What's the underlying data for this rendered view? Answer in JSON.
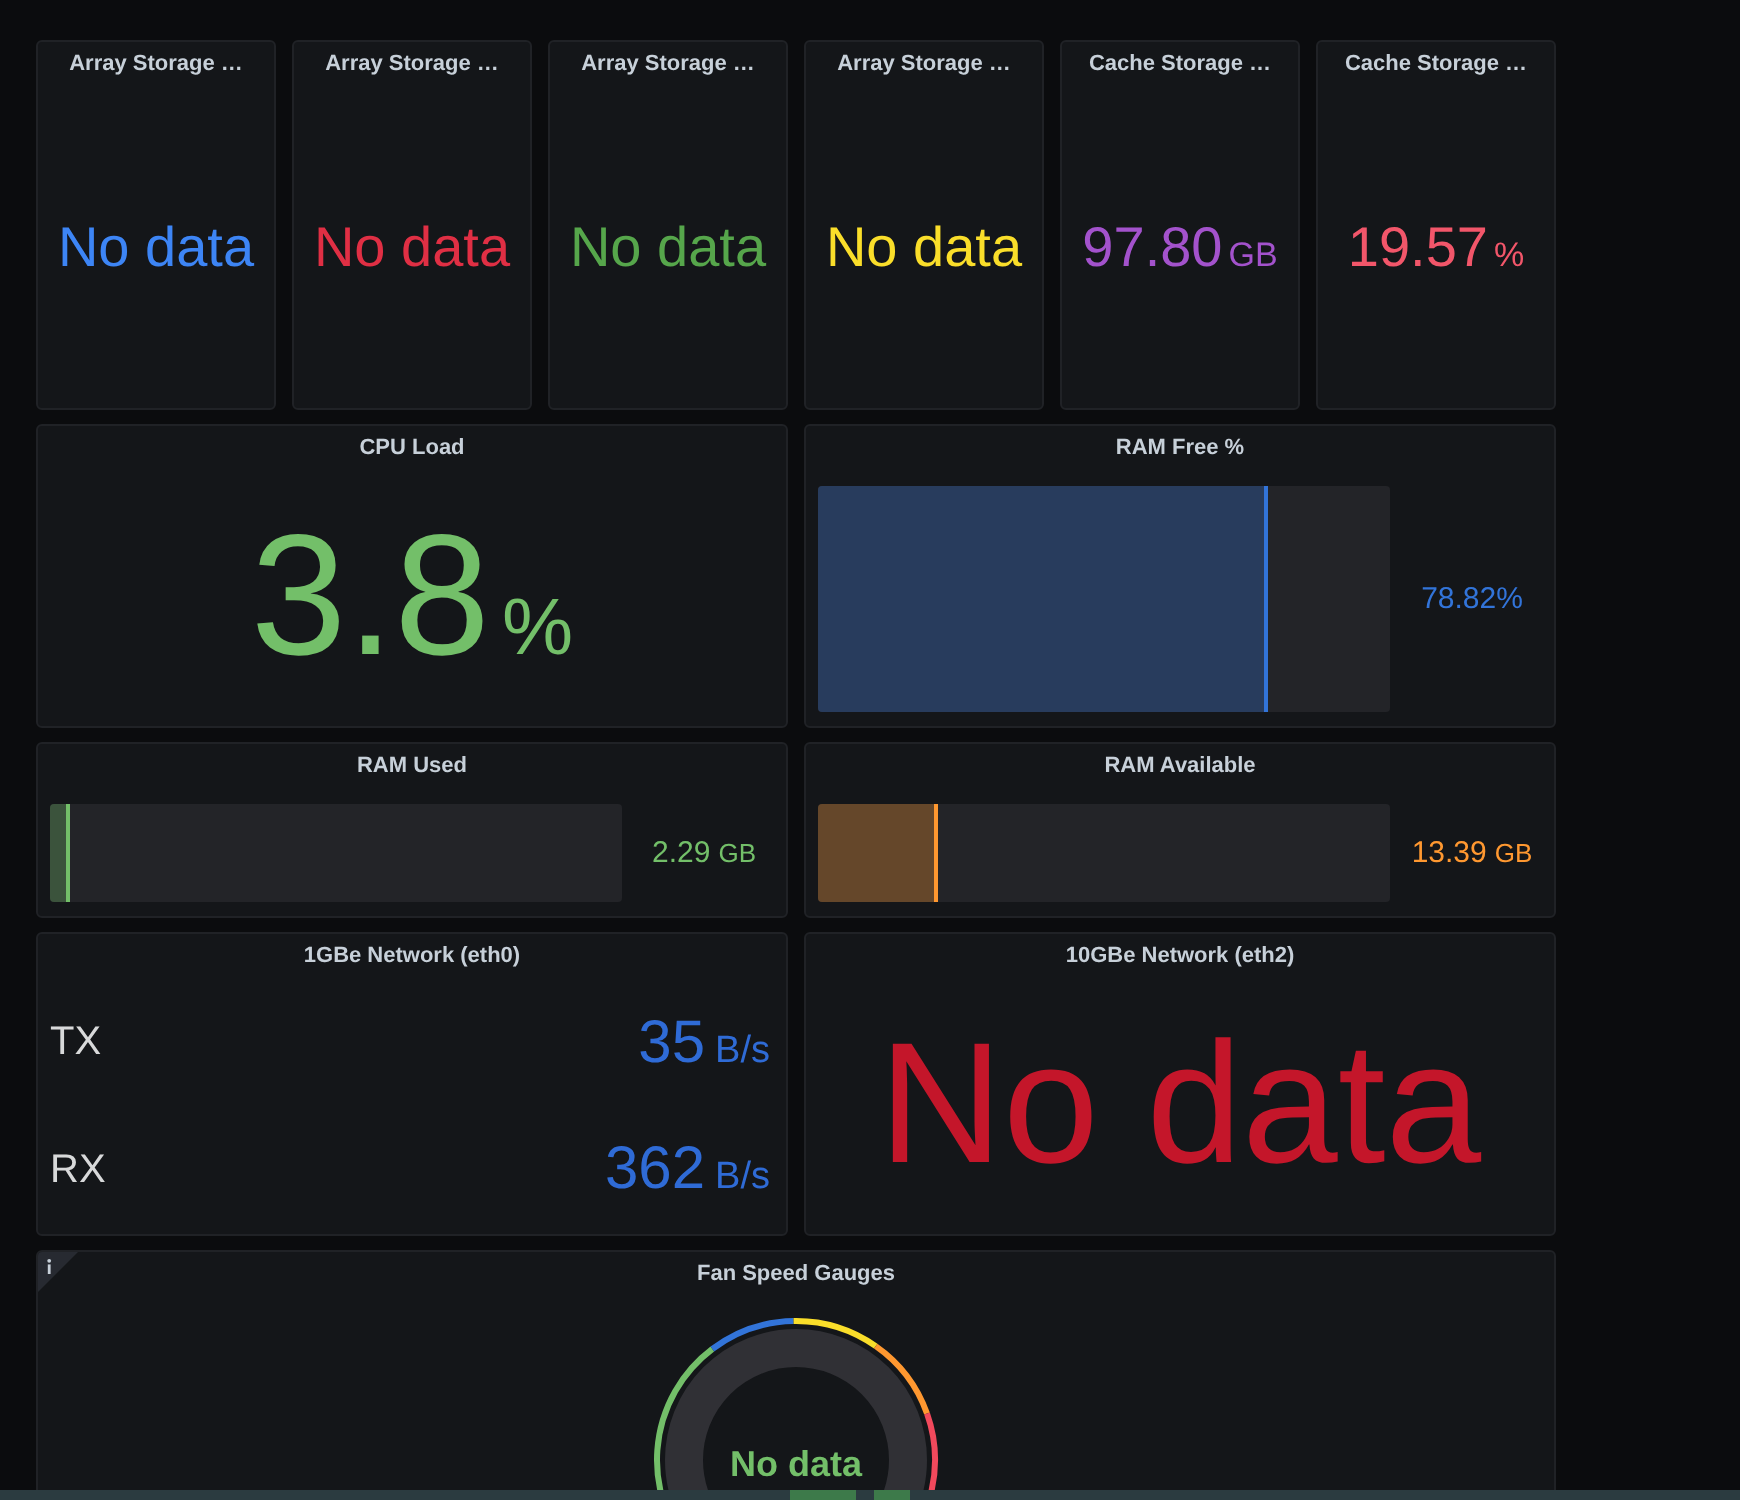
{
  "rows": [
    {
      "panels": [
        {
          "kind": "stat",
          "title": "Array Storage …",
          "value": "No data",
          "color": "#3d85f5"
        },
        {
          "kind": "stat",
          "title": "Array Storage …",
          "value": "No data",
          "color": "#e02f44"
        },
        {
          "kind": "stat",
          "title": "Array Storage …",
          "value": "No data",
          "color": "#56a64b"
        },
        {
          "kind": "stat",
          "title": "Array Storage …",
          "value": "No data",
          "color": "#fade2a"
        },
        {
          "kind": "stat",
          "title": "Cache Storage …",
          "value": "97.80",
          "unit": "GB",
          "color": "#a352cc"
        },
        {
          "kind": "stat",
          "title": "Cache Storage …",
          "value": "19.57",
          "unit": "%",
          "color": "#f2566a"
        }
      ]
    },
    {
      "panels": [
        {
          "kind": "big_stat",
          "title": "CPU Load",
          "value": "3.8",
          "unit": "%",
          "color": "#73bf69"
        },
        {
          "kind": "bar_gauge",
          "title": "RAM Free %",
          "level": 0.7882,
          "value": "78.82%",
          "color": "#3274d9"
        }
      ]
    },
    {
      "panels": [
        {
          "kind": "bar_gauge",
          "title": "RAM Used",
          "level": 0.035,
          "value": "2.29",
          "unit": "GB",
          "color": "#73bf69"
        },
        {
          "kind": "bar_gauge",
          "title": "RAM Available",
          "level": 0.21,
          "value": "13.39",
          "unit": "GB",
          "color": "#ff9830"
        }
      ]
    },
    {
      "panels": [
        {
          "kind": "multi_stat",
          "title": "1GBe Network (eth0)",
          "color": "#2f6bd6",
          "series": [
            {
              "label": "TX",
              "value": "35",
              "unit": "B/s"
            },
            {
              "label": "RX",
              "value": "362",
              "unit": "B/s"
            }
          ]
        },
        {
          "kind": "big_stat",
          "title": "10GBe Network (eth2)",
          "value": "No data",
          "color": "#c4162a"
        }
      ]
    },
    {
      "panels": [
        {
          "kind": "gauge",
          "title": "Fan Speed Gauges",
          "info": true,
          "value": "No data",
          "color": "#73bf69"
        }
      ]
    }
  ]
}
